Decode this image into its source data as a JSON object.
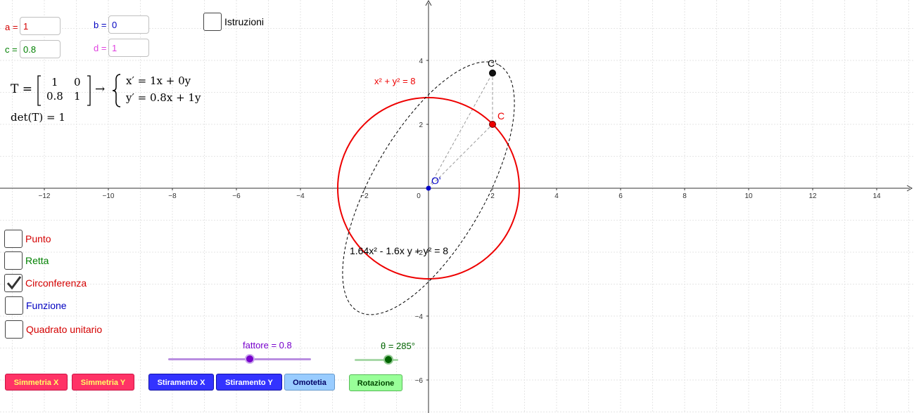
{
  "inputs": {
    "a": {
      "label": "a =",
      "value": "1",
      "color": "#d40000"
    },
    "b": {
      "label": "b =",
      "value": "0",
      "color": "#0000c0"
    },
    "c": {
      "label": "c =",
      "value": "0.8",
      "color": "#008000"
    },
    "d": {
      "label": "d =",
      "value": "1",
      "color": "#e040e0"
    }
  },
  "instructions_checkbox": {
    "label": "Istruzioni",
    "checked": false
  },
  "matrix": {
    "lhs": "T =",
    "m11": "1",
    "m12": "0",
    "m21": "0.8",
    "m22": "1",
    "arrow": "→",
    "eq1": "x′ = 1x + 0y",
    "eq2": "y′ = 0.8x + 1y",
    "det": "det(T) = 1"
  },
  "checkboxes": [
    {
      "label": "Punto",
      "checked": false,
      "color": "#d40000"
    },
    {
      "label": "Retta",
      "checked": false,
      "color": "#008000"
    },
    {
      "label": "Circonferenza",
      "checked": true,
      "color": "#d40000"
    },
    {
      "label": "Funzione",
      "checked": false,
      "color": "#0000c0"
    },
    {
      "label": "Quadrato unitario",
      "checked": false,
      "color": "#d40000"
    }
  ],
  "sliders": {
    "fattore": {
      "label": "fattore = 0.8",
      "value": 0.8,
      "color": "#7700cc"
    },
    "theta": {
      "label": "θ = 285°",
      "value": 285,
      "color": "#006400"
    }
  },
  "buttons": [
    {
      "label": "Simmetria X",
      "bg": "#ff3366",
      "fg": "#ffff66"
    },
    {
      "label": "Simmetria Y",
      "bg": "#ff3366",
      "fg": "#ffff66"
    },
    {
      "label": "Stiramento X",
      "bg": "#3333ff",
      "fg": "#ffffff"
    },
    {
      "label": "Stiramento Y",
      "bg": "#3333ff",
      "fg": "#ffffff"
    },
    {
      "label": "Omotetia",
      "bg": "#99ccff",
      "fg": "#000066"
    },
    {
      "label": "Rotazione",
      "bg": "#99ff99",
      "fg": "#004400"
    }
  ],
  "graph": {
    "x_ticks": [
      "−12",
      "−10",
      "−8",
      "−6",
      "−4",
      "−2",
      "0",
      "2",
      "4",
      "6",
      "8",
      "10",
      "12",
      "14"
    ],
    "y_ticks": [
      "4",
      "2",
      "−2",
      "−4",
      "−6"
    ],
    "circle_label": "x² + y² = 8",
    "ellipse_label": "1.64x² - 1.6x y + y² = 8",
    "point_C": "C",
    "point_Cp": "C'",
    "point_O": "O'",
    "circle_color": "#ee0000",
    "point_O_color": "#0000cc"
  }
}
